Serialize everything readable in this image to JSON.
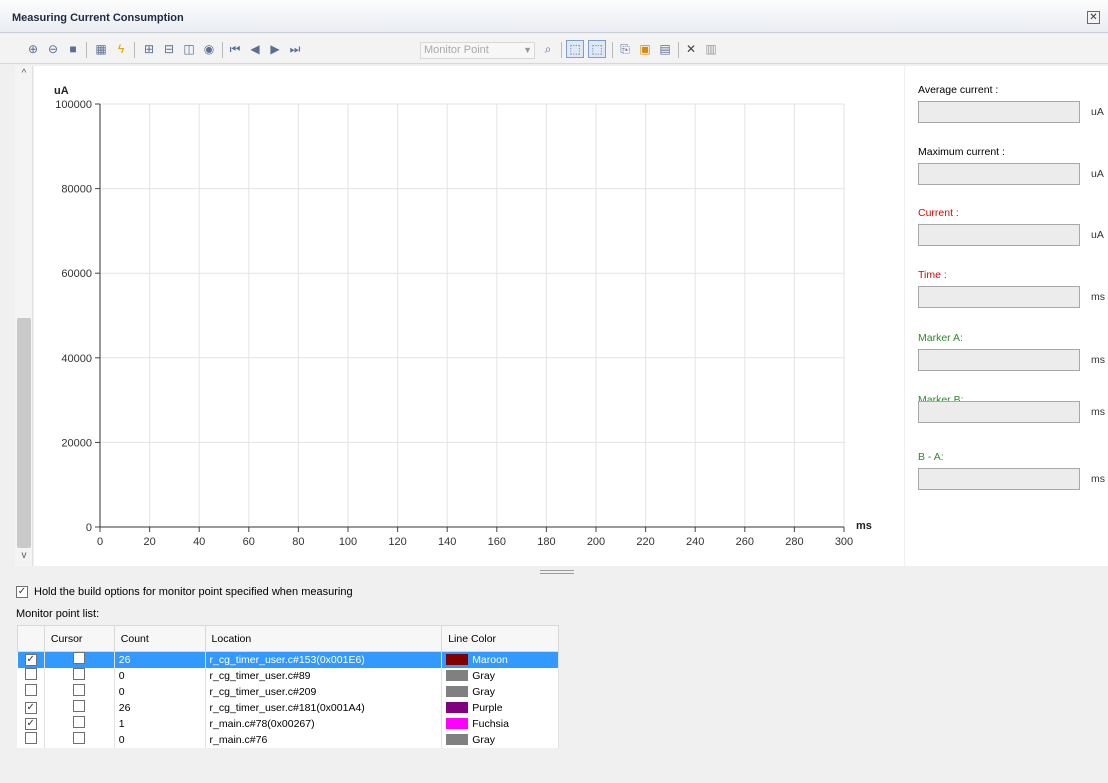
{
  "window": {
    "title": "Measuring Current Consumption"
  },
  "toolbar": {
    "monitor_point_placeholder": "Monitor Point",
    "icons": [
      "zoom-in-icon",
      "zoom-out-icon",
      "stop-icon",
      "settings-icon",
      "flash-icon",
      "fit-icon",
      "fit-v-icon",
      "fit-h-icon",
      "hide-icon",
      "first-icon",
      "prev-icon",
      "next-icon",
      "last-icon",
      "search-icon",
      "cursor-mode-icon",
      "marker-mode-icon",
      "export-icon",
      "save-image-icon",
      "save-icon",
      "delete-icon",
      "properties-icon"
    ]
  },
  "chart_data": {
    "type": "line",
    "ylabel": "uA",
    "xlabel": "ms",
    "xlim": [
      0,
      300
    ],
    "ylim": [
      0,
      100000
    ],
    "xticks": [
      "0",
      "20",
      "40",
      "60",
      "80",
      "100",
      "120",
      "140",
      "160",
      "180",
      "200",
      "220",
      "240",
      "260",
      "280",
      "300"
    ],
    "yticks": [
      "0",
      "20000",
      "40000",
      "60000",
      "80000",
      "100000"
    ],
    "grid": true,
    "series": []
  },
  "side": {
    "average_label": "Average current :",
    "maximum_label": "Maximum current :",
    "current_label": "Current :",
    "time_label": "Time :",
    "marker_a_label": "Marker A:",
    "marker_b_label": "Marker B:",
    "b_minus_a_label": "B - A:",
    "unit_ua": "uA",
    "unit_ms": "ms",
    "colors": {
      "current": "#e60000",
      "time": "#e60000",
      "marker": "#2d8a2d"
    }
  },
  "hold_option": {
    "label": "Hold the build options for monitor point specified when measuring",
    "checked": true
  },
  "monitor_list": {
    "title": "Monitor point list:",
    "columns": [
      "",
      "Cursor",
      "Count",
      "Location",
      "Line Color"
    ],
    "rows": [
      {
        "enabled": true,
        "cursor": false,
        "count": "26",
        "location": "r_cg_timer_user.c#153(0x001E6)",
        "color_name": "Maroon",
        "color": "#800000",
        "selected": true
      },
      {
        "enabled": false,
        "cursor": false,
        "count": "0",
        "location": "r_cg_timer_user.c#89",
        "color_name": "Gray",
        "color": "#808080",
        "selected": false
      },
      {
        "enabled": false,
        "cursor": false,
        "count": "0",
        "location": "r_cg_timer_user.c#209",
        "color_name": "Gray",
        "color": "#808080",
        "selected": false
      },
      {
        "enabled": true,
        "cursor": false,
        "count": "26",
        "location": "r_cg_timer_user.c#181(0x001A4)",
        "color_name": "Purple",
        "color": "#800080",
        "selected": false
      },
      {
        "enabled": true,
        "cursor": false,
        "count": "1",
        "location": "r_main.c#78(0x00267)",
        "color_name": "Fuchsia",
        "color": "#ff00ff",
        "selected": false
      },
      {
        "enabled": false,
        "cursor": false,
        "count": "0",
        "location": "r_main.c#76",
        "color_name": "Gray",
        "color": "#808080",
        "selected": false
      }
    ]
  }
}
